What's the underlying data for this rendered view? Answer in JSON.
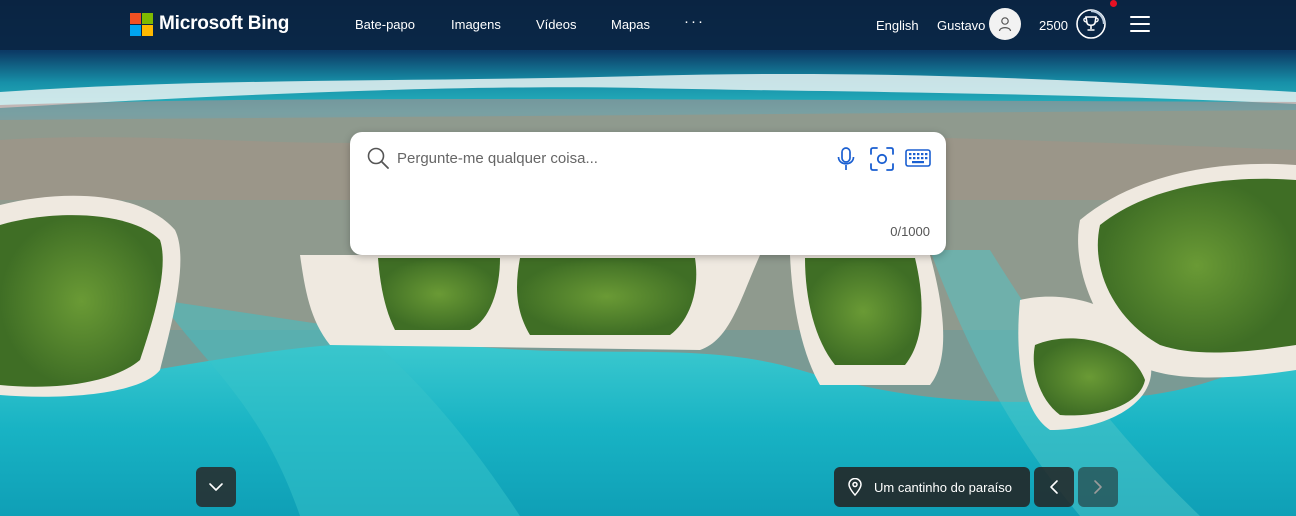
{
  "header": {
    "brand": "Microsoft Bing",
    "nav": [
      {
        "label": "Bate-papo"
      },
      {
        "label": "Imagens"
      },
      {
        "label": "Vídeos"
      },
      {
        "label": "Mapas"
      },
      {
        "label": "···"
      }
    ],
    "language": "English",
    "user_name": "Gustavo",
    "points": "2500",
    "icons": [
      "microsoft-logo",
      "user-icon",
      "rewards-trophy-icon",
      "hamburger-menu-icon"
    ]
  },
  "search": {
    "placeholder": "Pergunte-me qualquer coisa...",
    "value": "",
    "counter": "0/1000",
    "icons": [
      "search-icon",
      "microphone-icon",
      "visual-search-camera-icon",
      "keyboard-icon"
    ]
  },
  "footer": {
    "caption": "Um cantinho do paraíso",
    "icons": [
      "chevron-down-icon",
      "location-pin-icon",
      "chevron-left-icon",
      "chevron-right-icon"
    ]
  },
  "colors": {
    "accent": "#1a5fd1",
    "ocean": "#1fb7c6",
    "sky_band": "#0a2747"
  }
}
